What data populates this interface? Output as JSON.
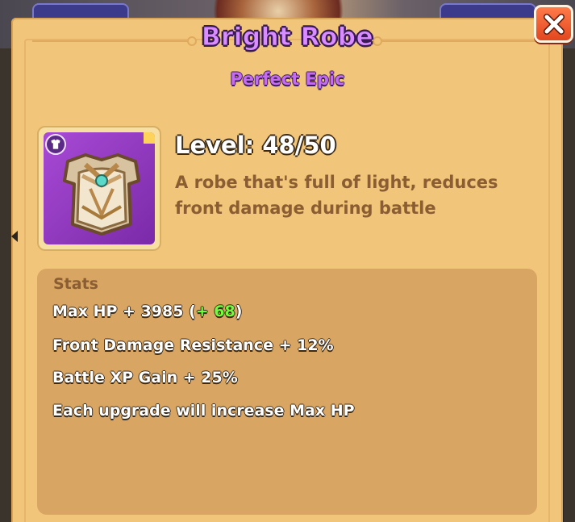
{
  "dialog": {
    "title": "Bright Robe",
    "rarity": "Perfect Epic",
    "close_icon": "close-x-icon"
  },
  "item": {
    "icon": "robe-armor-icon",
    "type_icon": "armor-type-icon",
    "level_label": "Level: 48/50",
    "description": "A robe that's full of light, reduces front damage during battle"
  },
  "stats": {
    "header": "Stats",
    "max_hp_prefix": "Max HP + 3985 (",
    "max_hp_bonus": "+ 68",
    "max_hp_suffix": ")",
    "front_damage": "Front Damage Resistance + 12%",
    "battle_xp": "Battle XP Gain + 25%",
    "upgrade_note": "Each upgrade will increase Max HP"
  },
  "colors": {
    "panel": "#f1c57a",
    "stats_panel": "#d9a563",
    "title_purple": "#d98cff",
    "rarity_purple": "#c46cf0",
    "bonus_green": "#6cff3a",
    "close_red": "#e2471e"
  }
}
